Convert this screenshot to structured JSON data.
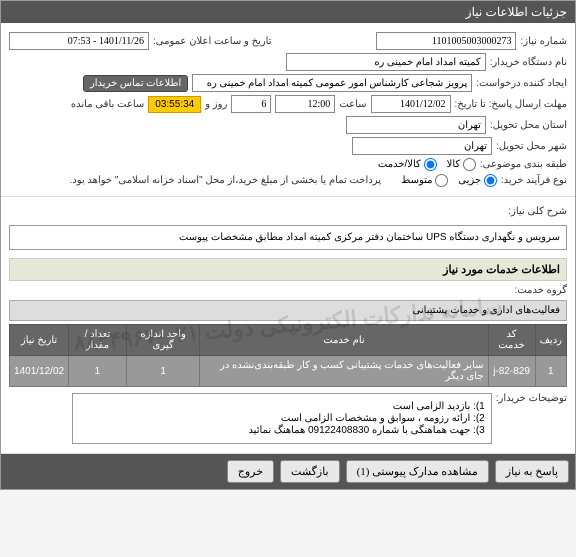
{
  "header": {
    "title": "جزئیات اطلاعات نیاز"
  },
  "fields": {
    "need_no_label": "شماره نیاز:",
    "need_no": "1101005003000273",
    "announce_label": "تاریخ و ساعت اعلان عمومی:",
    "announce_value": "1401/11/26 - 07:53",
    "buyer_org_label": "نام دستگاه خریدار:",
    "buyer_org": "کمیته امداد امام خمینی ره",
    "requester_label": "ایجاد کننده درخواست:",
    "requester": "پرویز شجاعی کارشناس امور عمومی کمیته امداد امام خمینی ره",
    "contact_btn": "اطلاعات تماس خریدار",
    "deadline_label": "مهلت ارسال پاسخ: تا تاریخ:",
    "deadline_date": "1401/12/02",
    "time_label": "ساعت",
    "deadline_time": "12:00",
    "days_label": "روز و",
    "days_value": "6",
    "remain_time": "03:55:34",
    "remain_label": "ساعت باقی مانده",
    "province_label": "استان محل تحویل:",
    "province": "تهران",
    "city_label": "شهر محل تحویل:",
    "city": "تهران",
    "category_label": "طبقه بندی موضوعی:",
    "cat_goods": "کالا",
    "cat_both": "کالا/خدمت",
    "process_label": "نوع فرآیند خرید:",
    "proc_partial": "جزیی",
    "proc_medium": "متوسط",
    "proc_note": "پرداخت تمام یا بخشی از مبلغ خرید،از محل \"اسناد خزانه اسلامی\" خواهد بود."
  },
  "need": {
    "title_label": "شرح کلی نیاز:",
    "title_text": "سرویس و نگهداری دستگاه UPS ساختمان دفتر مرکزی کمیته امداد مطابق مشخصات پیوست",
    "services_header": "اطلاعات خدمات مورد نیاز",
    "group_label": "گروه خدمت:",
    "group_value": "فعالیت‌های اداری و خدمات پشتیبانی"
  },
  "table": {
    "headers": [
      "ردیف",
      "کد خدمت",
      "نام خدمت",
      "واحد اندازه گیری",
      "تعداد / مقدار",
      "تاریخ نیاز"
    ],
    "rows": [
      {
        "idx": "1",
        "code": "j-82-829",
        "name": "سایر فعالیت‌های خدمات پشتیبانی کسب و کار طبقه‌بندی‌نشده در جای دیگر",
        "unit": "1",
        "qty": "1",
        "date": "1401/12/02"
      }
    ]
  },
  "notes": {
    "label": "توضیحات خریدار:",
    "lines": [
      "1): بازدید الزامی است",
      "2): ارائه رزومه ، سوابق و مشخصات الزامی است",
      "3): جهت هماهنگی با شماره 09122408830 هماهنگ نمائید"
    ]
  },
  "watermark": "سامانه تدارکات الکترونیکی دولت ۰۲۱-۸۸۳۴۹۶۷",
  "footer": {
    "reply": "پاسخ به نیاز",
    "attachments": "مشاهده مدارک پیوستی (1)",
    "back": "بازگشت",
    "close": "خروج"
  }
}
